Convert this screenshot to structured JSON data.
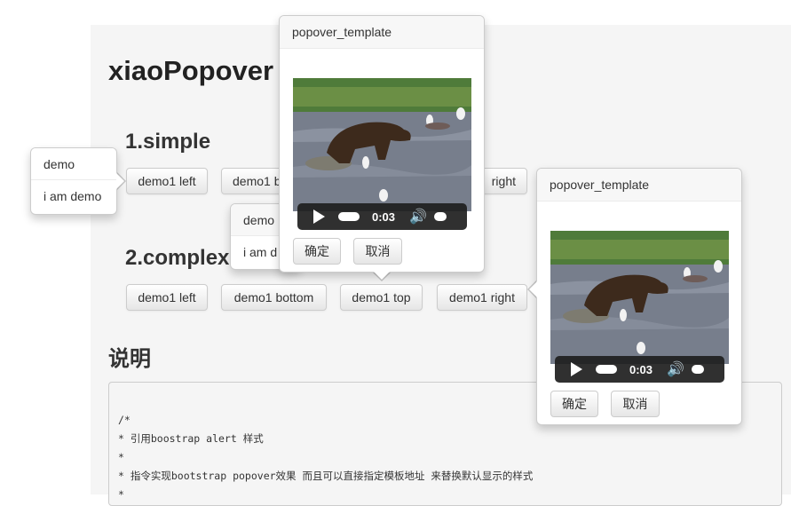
{
  "page": {
    "title": "xiaoPopover",
    "section1": "1.simple",
    "section2": "2.complex",
    "section3": "说明"
  },
  "buttons_simple": {
    "left": "demo1 left",
    "bottom": "demo1 b",
    "right": "right"
  },
  "buttons_complex": {
    "left": "demo1 left",
    "bottom": "demo1 bottom",
    "top": "demo1 top",
    "right": "demo1 right"
  },
  "popover_demo_left": {
    "title": "demo",
    "body": "i am demo"
  },
  "popover_demo_bottom": {
    "title": "demo",
    "body": "i am d"
  },
  "popover_template_top": {
    "title": "popover_template",
    "video_time": "0:03",
    "ok": "确定",
    "cancel": "取消"
  },
  "popover_template_right": {
    "title": "popover_template",
    "video_time": "0:03",
    "ok": "确定",
    "cancel": "取消"
  },
  "code": {
    "lines": [
      "/*",
      "* 引用boostrap alert 样式",
      "*",
      "* 指令实现bootstrap popover效果 而且可以直接指定模板地址 来替换默认显示的样式",
      "*"
    ]
  },
  "colors": {
    "content_bg": "#f5f5f5",
    "popover_title_bg": "#f7f7f7",
    "video_controls_bg": "#1e1e1e"
  }
}
